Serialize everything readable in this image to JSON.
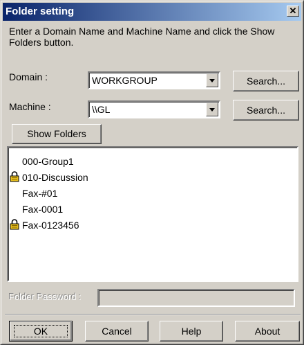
{
  "window": {
    "title": "Folder setting",
    "close_glyph": "✕"
  },
  "instructions": "Enter a Domain Name and Machine Name and click the Show Folders button.",
  "domain": {
    "label": "Domain :",
    "value": "WORKGROUP",
    "search_label": "Search..."
  },
  "machine": {
    "label": "Machine :",
    "value": "\\\\GL",
    "search_label": "Search..."
  },
  "show_folders_label": "Show Folders",
  "folders": [
    {
      "name": "000-Group1",
      "locked": false
    },
    {
      "name": "010-Discussion",
      "locked": true
    },
    {
      "name": "Fax-#01",
      "locked": false
    },
    {
      "name": "Fax-0001",
      "locked": false
    },
    {
      "name": "Fax-0123456",
      "locked": true
    }
  ],
  "password": {
    "label": "Folder Password :",
    "value": ""
  },
  "buttons": {
    "ok": "OK",
    "cancel": "Cancel",
    "help": "Help",
    "about": "About"
  },
  "colors": {
    "titlebar_start": "#0a246a",
    "titlebar_end": "#a6caf0",
    "face": "#d4d0c8",
    "lock": "#e8c020"
  },
  "icons": {
    "lock": "padlock-icon",
    "close": "close-icon",
    "dropdown": "chevron-down-icon"
  }
}
